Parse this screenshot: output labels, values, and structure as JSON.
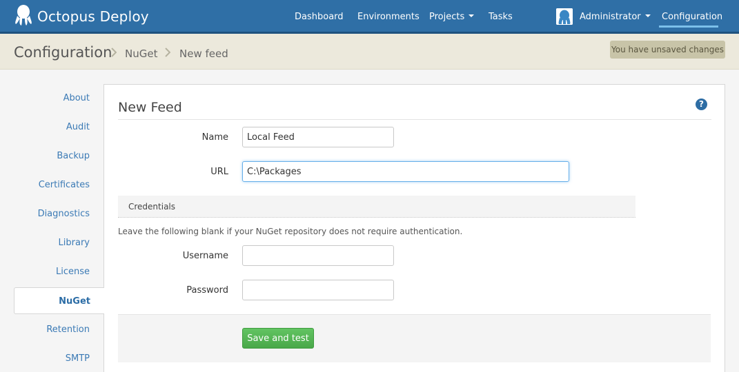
{
  "app": {
    "brand": "Octopus Deploy"
  },
  "nav": {
    "dashboard": "Dashboard",
    "environments": "Environments",
    "projects": "Projects",
    "tasks": "Tasks",
    "user": "Administrator",
    "configuration": "Configuration"
  },
  "breadcrumb": {
    "root": "Configuration",
    "section": "NuGet",
    "current": "New feed"
  },
  "status": {
    "unsaved": "You have unsaved changes"
  },
  "sidebar": {
    "items": [
      {
        "label": "About"
      },
      {
        "label": "Audit"
      },
      {
        "label": "Backup"
      },
      {
        "label": "Certificates"
      },
      {
        "label": "Diagnostics"
      },
      {
        "label": "Library"
      },
      {
        "label": "License"
      },
      {
        "label": "NuGet",
        "active": true
      },
      {
        "label": "Retention"
      },
      {
        "label": "SMTP"
      }
    ]
  },
  "form": {
    "title": "New Feed",
    "help_icon": "?",
    "name_label": "Name",
    "name_value": "Local Feed",
    "url_label": "URL",
    "url_value": "C:\\Packages",
    "credentials_heading": "Credentials",
    "credentials_help": "Leave the following blank if your NuGet repository does not require authentication.",
    "username_label": "Username",
    "username_value": "",
    "password_label": "Password",
    "password_value": "",
    "save_label": "Save and test"
  },
  "colors": {
    "topbar": "#2f6fa6",
    "accent_link": "#3b7ab5",
    "save_button": "#5cb85c",
    "unsaved_badge": "#c8c4a8"
  },
  "icons": {
    "logo": "octopus-logo-icon",
    "avatar": "octopus-avatar-icon",
    "help": "question-circle-icon",
    "breadcrumb_separator": "chevron-right-icon"
  }
}
